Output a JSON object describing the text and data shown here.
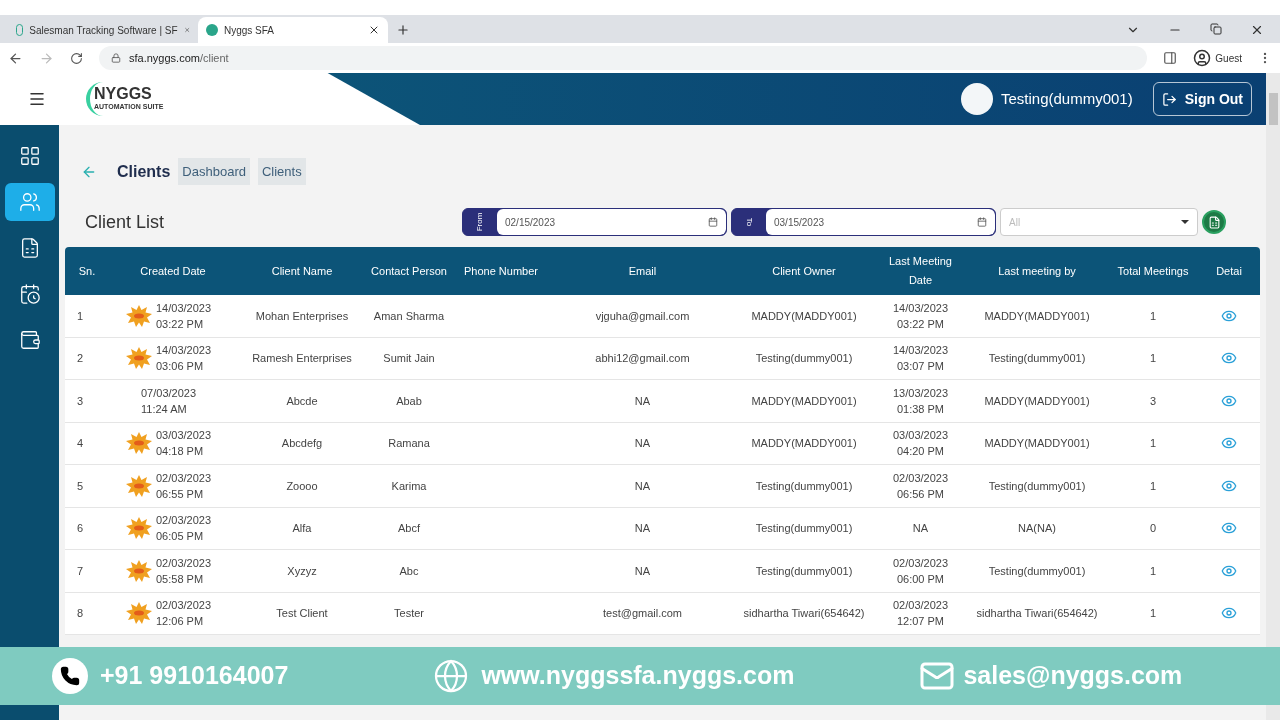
{
  "browser": {
    "tabs": [
      {
        "title": "Salesman Tracking Software | SF",
        "selected": false
      },
      {
        "title": "Nyggs SFA",
        "selected": true
      }
    ],
    "url_host": "sfa.nyggs.com",
    "url_path": "/client",
    "profile": "Guest"
  },
  "header": {
    "logo": "NYGGS",
    "logo_tagline": "AUTOMATION SUITE",
    "user": "Testing(dummy001)",
    "sign_out": "Sign Out"
  },
  "sidebar": {
    "items": [
      {
        "kind": "dashboard",
        "selected": false
      },
      {
        "kind": "clients",
        "selected": true
      },
      {
        "kind": "reports",
        "selected": false
      },
      {
        "kind": "calendar",
        "selected": false
      },
      {
        "kind": "wallet",
        "selected": false
      }
    ]
  },
  "breadcrumb": {
    "title": "Clients",
    "links": [
      "Dashboard",
      "Clients"
    ]
  },
  "page_title": "Client List",
  "filters": {
    "from_label": "From",
    "from_value": "02/15/2023",
    "to_label": "To",
    "to_value": "03/15/2023",
    "select_value": "All"
  },
  "table": {
    "columns": [
      "Sn.",
      "Created Date",
      "Client Name",
      "Contact Person",
      "Phone Number",
      "Email",
      "Client Owner",
      "Last Meeting Date",
      "Last meeting by",
      "Total Meetings",
      "Detai"
    ],
    "rows": [
      {
        "sn": "1",
        "is_new": true,
        "created": "14/03/2023 03:22 PM",
        "client": "Mohan Enterprises",
        "contact": "Aman Sharma",
        "email": "vjguha@gmail.com",
        "owner": "MADDY(MADDY001)",
        "last_date": "14/03/2023 03:22 PM",
        "last_by": "MADDY(MADDY001)",
        "total": "1"
      },
      {
        "sn": "2",
        "is_new": true,
        "created": "14/03/2023 03:06 PM",
        "client": "Ramesh Enterprises",
        "contact": "Sumit Jain",
        "email": "abhi12@gmail.com",
        "owner": "Testing(dummy001)",
        "last_date": "14/03/2023 03:07 PM",
        "last_by": "Testing(dummy001)",
        "total": "1"
      },
      {
        "sn": "3",
        "is_new": false,
        "created": "07/03/2023 11:24 AM",
        "client": "Abcde",
        "contact": "Abab",
        "email": "NA",
        "owner": "MADDY(MADDY001)",
        "last_date": "13/03/2023 01:38 PM",
        "last_by": "MADDY(MADDY001)",
        "total": "3"
      },
      {
        "sn": "4",
        "is_new": true,
        "created": "03/03/2023 04:18 PM",
        "client": "Abcdefg",
        "contact": "Ramana",
        "email": "NA",
        "owner": "MADDY(MADDY001)",
        "last_date": "03/03/2023 04:20 PM",
        "last_by": "MADDY(MADDY001)",
        "total": "1"
      },
      {
        "sn": "5",
        "is_new": true,
        "created": "02/03/2023 06:55 PM",
        "client": "Zoooo",
        "contact": "Karima",
        "email": "NA",
        "owner": "Testing(dummy001)",
        "last_date": "02/03/2023 06:56 PM",
        "last_by": "Testing(dummy001)",
        "total": "1"
      },
      {
        "sn": "6",
        "is_new": true,
        "created": "02/03/2023 06:05 PM",
        "client": "Alfa",
        "contact": "Abcf",
        "email": "NA",
        "owner": "Testing(dummy001)",
        "last_date": "NA",
        "last_by": "NA(NA)",
        "total": "0"
      },
      {
        "sn": "7",
        "is_new": true,
        "created": "02/03/2023 05:58 PM",
        "client": "Xyzyz",
        "contact": "Abc",
        "email": "NA",
        "owner": "Testing(dummy001)",
        "last_date": "02/03/2023 06:00 PM",
        "last_by": "Testing(dummy001)",
        "total": "1"
      },
      {
        "sn": "8",
        "is_new": true,
        "created": "02/03/2023 12:06 PM",
        "client": "Test Client",
        "contact": "Tester",
        "email": "test@gmail.com",
        "owner": "sidhartha Tiwari(654642)",
        "last_date": "02/03/2023 12:07 PM",
        "last_by": "sidhartha Tiwari(654642)",
        "total": "1"
      }
    ]
  },
  "banner": {
    "phone": "+91 9910164007",
    "website": "www.nyggssfa.nyggs.com",
    "email": "sales@nyggs.com"
  }
}
